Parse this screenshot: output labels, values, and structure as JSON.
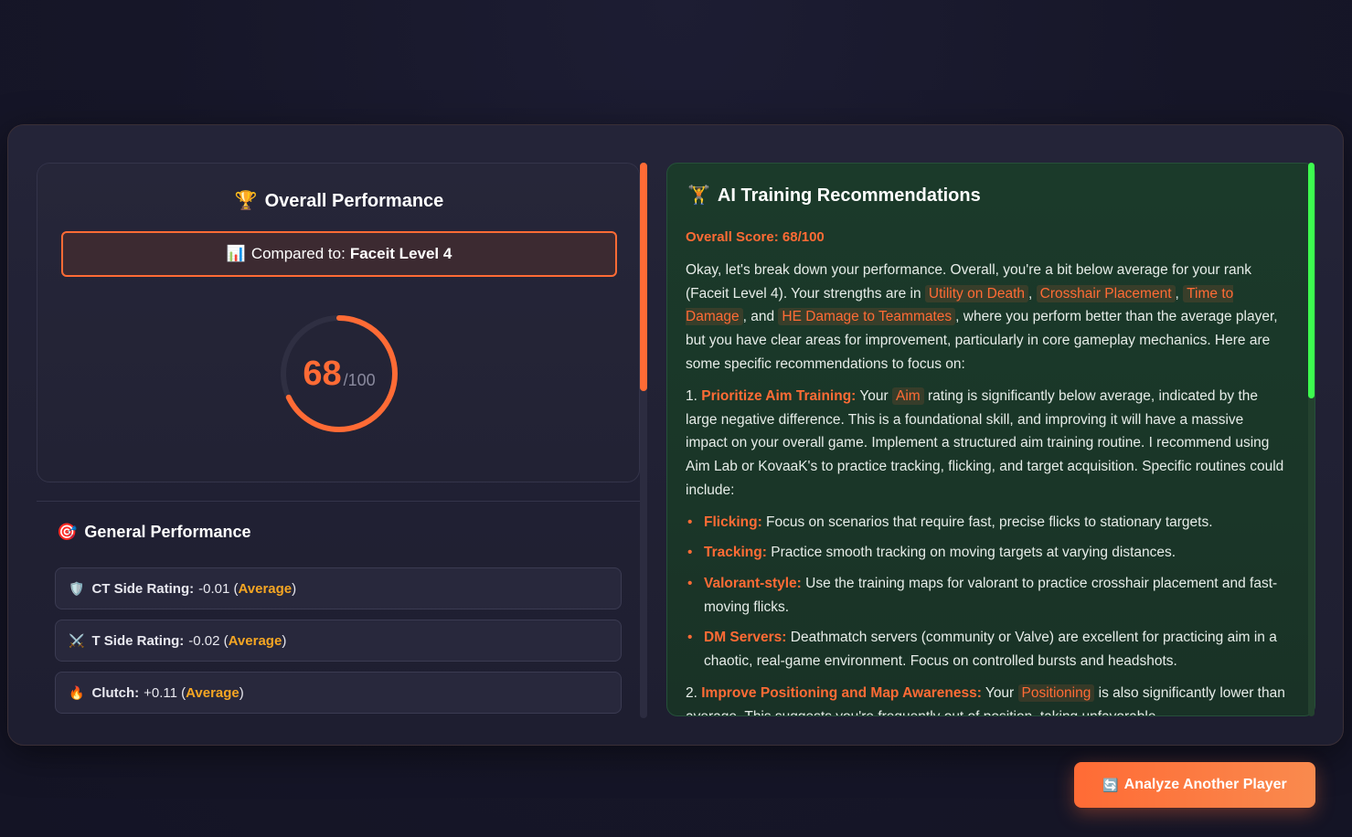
{
  "overall": {
    "icon": "trophy-icon",
    "icon_glyph": "🏆",
    "title": "Overall Performance",
    "compare_icon": "bar-chart-icon",
    "compare_glyph": "📊",
    "compare_label": "Compared to:",
    "compare_value": "Faceit Level 4",
    "score": "68",
    "score_max": "/100",
    "score_fraction": 0.68,
    "accent": "#ff6b35"
  },
  "general": {
    "icon": "target-icon",
    "icon_glyph": "🎯",
    "title": "General Performance",
    "stats": [
      {
        "icon": "shield-icon",
        "glyph": "🛡️",
        "label": "CT Side Rating:",
        "value": "-0.01",
        "level": "Average"
      },
      {
        "icon": "swords-icon",
        "glyph": "⚔️",
        "label": "T Side Rating:",
        "value": "-0.02",
        "level": "Average"
      },
      {
        "icon": "fire-icon",
        "glyph": "🔥",
        "label": "Clutch:",
        "value": "+0.11",
        "level": "Average"
      }
    ]
  },
  "recommendations": {
    "icon": "dumbbell-icon",
    "icon_glyph": "🏋",
    "title": "AI Training Recommendations",
    "score_line": "Overall Score: 68/100",
    "intro": {
      "t1": "Okay, let's break down your performance. Overall, you're a bit below average for your rank (Faceit Level 4). Your strengths are in ",
      "h1": "Utility on Death",
      "t2": ", ",
      "h2": "Crosshair Placement",
      "t3": ", ",
      "h3": "Time to Damage",
      "t4": ", and ",
      "h4": "HE Damage to Teammates",
      "t5": ", where you perform better than the average player, but you have clear areas for improvement, particularly in core gameplay mechanics. Here are some specific recommendations to focus on:"
    },
    "item1": {
      "num": "1.",
      "heading": "Prioritize Aim Training:",
      "t1": " Your ",
      "h1": "Aim",
      "t2": " rating is significantly below average, indicated by the large negative difference. This is a foundational skill, and improving it will have a massive impact on your overall game. Implement a structured aim training routine. I recommend using Aim Lab or KovaaK's to practice tracking, flicking, and target acquisition. Specific routines could include:"
    },
    "bullets": [
      {
        "label": "Flicking:",
        "text": " Focus on scenarios that require fast, precise flicks to stationary targets."
      },
      {
        "label": "Tracking:",
        "text": " Practice smooth tracking on moving targets at varying distances."
      },
      {
        "label": "Valorant-style:",
        "text": " Use the training maps for valorant to practice crosshair placement and fast-moving flicks."
      },
      {
        "label": "DM Servers:",
        "text": " Deathmatch servers (community or Valve) are excellent for practicing aim in a chaotic, real-game environment. Focus on controlled bursts and headshots."
      }
    ],
    "item2": {
      "num": "2.",
      "heading": "Improve Positioning and Map Awareness:",
      "t1": " Your ",
      "h1": "Positioning",
      "t2": " is also significantly lower than average. This suggests you're frequently out of position, taking unfavorable"
    },
    "scroll_accent": "#3dfc4f"
  },
  "analyze_button": {
    "icon": "refresh-icon",
    "glyph": "🔄",
    "label": "Analyze Another Player"
  }
}
